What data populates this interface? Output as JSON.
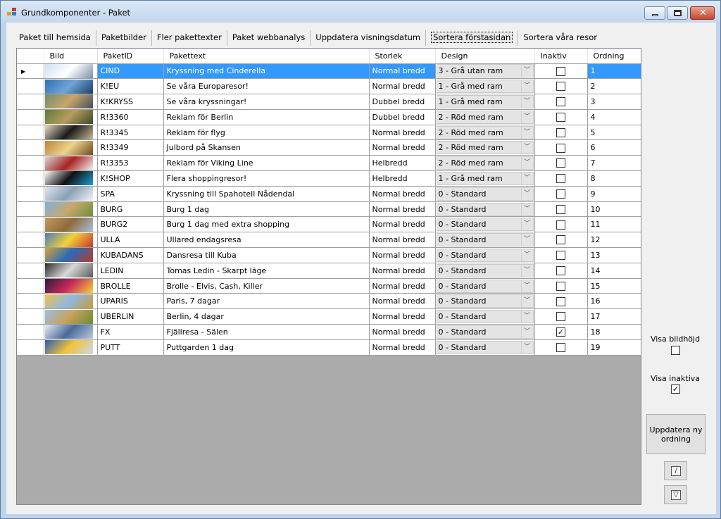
{
  "window": {
    "title": "Grundkomponenter - Paket",
    "icon": "app-icon"
  },
  "tabs": [
    {
      "label": "Paket till hemsida",
      "active": false
    },
    {
      "label": "Paketbilder",
      "active": false
    },
    {
      "label": "Fler pakettexter",
      "active": false
    },
    {
      "label": "Paket webbanalys",
      "active": false
    },
    {
      "label": "Uppdatera visningsdatum",
      "active": false
    },
    {
      "label": "Sortera förstasidan",
      "active": true
    },
    {
      "label": "Sortera våra resor",
      "active": false
    }
  ],
  "grid": {
    "columns": {
      "bild": "Bild",
      "paketid": "PaketID",
      "pakettext": "Pakettext",
      "storlek": "Storlek",
      "design": "Design",
      "inaktiv": "Inaktiv",
      "ordning": "Ordning"
    },
    "selected_row": 0,
    "rows": [
      {
        "paketid": "CIND",
        "pakettext": "Kryssning med Cinderella",
        "storlek": "Normal bredd",
        "design": "3 - Grå utan ram",
        "inaktiv": false,
        "ordning": "1",
        "thumb": [
          "#cfe0f0",
          "#ffffff",
          "#7a8fa8"
        ]
      },
      {
        "paketid": "K!EU",
        "pakettext": "Se våra Europaresor!",
        "storlek": "Normal bredd",
        "design": "1 - Grå med ram",
        "inaktiv": false,
        "ordning": "2",
        "thumb": [
          "#2f6fb8",
          "#6fa4d8",
          "#1c3f6b"
        ]
      },
      {
        "paketid": "K!KRYSS",
        "pakettext": "Se våra kryssningar!",
        "storlek": "Dubbel bredd",
        "design": "1 - Grå med ram",
        "inaktiv": false,
        "ordning": "3",
        "thumb": [
          "#6b8f6a",
          "#c9a66b",
          "#3f4f5c"
        ]
      },
      {
        "paketid": "R!3360",
        "pakettext": "Reklam för Berlin",
        "storlek": "Dubbel bredd",
        "design": "2 - Röd med ram",
        "inaktiv": false,
        "ordning": "4",
        "thumb": [
          "#5a7d3c",
          "#b89b5e",
          "#394a2a"
        ]
      },
      {
        "paketid": "R!3345",
        "pakettext": "Reklam för flyg",
        "storlek": "Normal bredd",
        "design": "2 - Röd med ram",
        "inaktiv": false,
        "ordning": "5",
        "thumb": [
          "#e9dcc0",
          "#1a1a1a",
          "#c9b894"
        ]
      },
      {
        "paketid": "R!3349",
        "pakettext": "Julbord på Skansen",
        "storlek": "Normal bredd",
        "design": "2 - Röd med ram",
        "inaktiv": false,
        "ordning": "6",
        "thumb": [
          "#b8863a",
          "#f0d28a",
          "#6b4a1c"
        ]
      },
      {
        "paketid": "R!3353",
        "pakettext": "Reklam för Viking Line",
        "storlek": "Helbredd",
        "design": "2 - Röd med ram",
        "inaktiv": false,
        "ordning": "7",
        "thumb": [
          "#d8d8d8",
          "#a22",
          "#f4f4f4"
        ]
      },
      {
        "paketid": "K!SHOP",
        "pakettext": "Flera shoppingresor!",
        "storlek": "Helbredd",
        "design": "1 - Grå med ram",
        "inaktiv": false,
        "ordning": "8",
        "thumb": [
          "#ffffff",
          "#111111",
          "#1aa0d8"
        ]
      },
      {
        "paketid": "SPA",
        "pakettext": "Kryssning till Spahotell Nådendal",
        "storlek": "Normal bredd",
        "design": "0 - Standard",
        "inaktiv": false,
        "ordning": "9",
        "thumb": [
          "#dfe6ee",
          "#8aa0b8",
          "#f4f4f4"
        ]
      },
      {
        "paketid": "BURG",
        "pakettext": "Burg 1 dag",
        "storlek": "Normal bredd",
        "design": "0 - Standard",
        "inaktiv": false,
        "ordning": "10",
        "thumb": [
          "#7fb0e0",
          "#c8a86a",
          "#6d8f3d"
        ]
      },
      {
        "paketid": "BURG2",
        "pakettext": "Burg 1 dag med extra shopping",
        "storlek": "Normal bredd",
        "design": "0 - Standard",
        "inaktiv": false,
        "ordning": "11",
        "thumb": [
          "#c49a5c",
          "#8f6a3a",
          "#a9c1dc"
        ]
      },
      {
        "paketid": "ULLA",
        "pakettext": "Ullared endagsresa",
        "storlek": "Normal bredd",
        "design": "0 - Standard",
        "inaktiv": false,
        "ordning": "12",
        "thumb": [
          "#4a7ab8",
          "#f2d23a",
          "#c8342a"
        ]
      },
      {
        "paketid": "KUBADANS",
        "pakettext": "Dansresa till Kuba",
        "storlek": "Normal bredd",
        "design": "0 - Standard",
        "inaktiv": false,
        "ordning": "13",
        "thumb": [
          "#d8a23a",
          "#2a6ab8",
          "#b83a2a"
        ]
      },
      {
        "paketid": "LEDIN",
        "pakettext": "Tomas Ledin - Skarpt läge",
        "storlek": "Normal bredd",
        "design": "0 - Standard",
        "inaktiv": false,
        "ordning": "14",
        "thumb": [
          "#2a2a2a",
          "#d8d8d8",
          "#5a5a5a"
        ]
      },
      {
        "paketid": "BROLLE",
        "pakettext": "Brolle - Elvis, Cash, Killer",
        "storlek": "Normal bredd",
        "design": "0 - Standard",
        "inaktiv": false,
        "ordning": "15",
        "thumb": [
          "#2a1a3a",
          "#c82a5a",
          "#f4d23a"
        ]
      },
      {
        "paketid": "UPARIS",
        "pakettext": "Paris, 7 dagar",
        "storlek": "Normal bredd",
        "design": "0 - Standard",
        "inaktiv": false,
        "ordning": "16",
        "thumb": [
          "#f2c24a",
          "#8fb8e0",
          "#c89a3a"
        ]
      },
      {
        "paketid": "UBERLIN",
        "pakettext": "Berlin, 4 dagar",
        "storlek": "Normal bredd",
        "design": "0 - Standard",
        "inaktiv": false,
        "ordning": "17",
        "thumb": [
          "#9ac0e8",
          "#c8a25a",
          "#6a8a3a"
        ]
      },
      {
        "paketid": "FX",
        "pakettext": "Fjällresa - Sälen",
        "storlek": "Normal bredd",
        "design": "0 - Standard",
        "inaktiv": true,
        "ordning": "18",
        "thumb": [
          "#e8eef6",
          "#4a6a9a",
          "#b8c8dc"
        ]
      },
      {
        "paketid": "PUTT",
        "pakettext": "Puttgarden 1 dag",
        "storlek": "Normal bredd",
        "design": "0 - Standard",
        "inaktiv": false,
        "ordning": "19",
        "thumb": [
          "#2a5ab8",
          "#f2c23a",
          "#c8d8ec"
        ]
      }
    ]
  },
  "side": {
    "visa_bildhojd_label": "Visa bildhöjd",
    "visa_bildhojd_checked": false,
    "visa_inaktiva_label": "Visa inaktiva",
    "visa_inaktiva_checked": true,
    "update_button_label": "Uppdatera ny ordning",
    "icon_button_1": "edit-icon",
    "icon_button_2": "filter-icon"
  },
  "colors": {
    "selection": "#3399ff",
    "grid_background": "#ababab"
  }
}
